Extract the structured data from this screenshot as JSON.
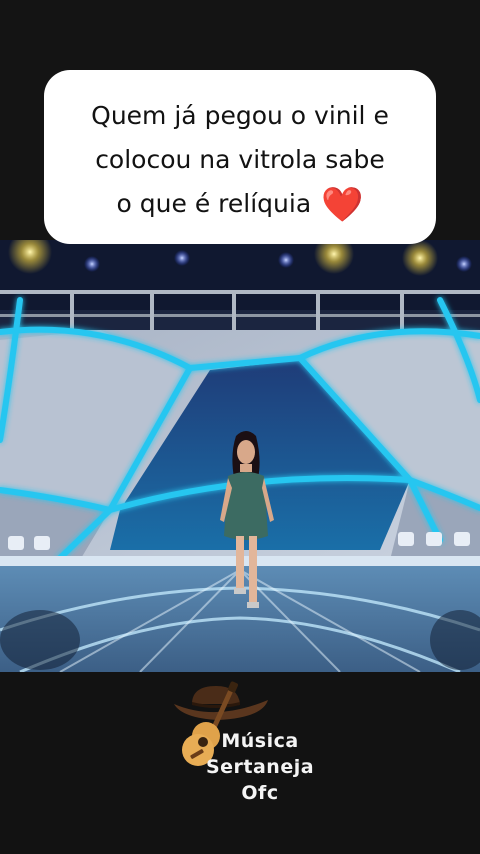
{
  "caption": {
    "line1": "Quem já pegou o vinil e",
    "line2": "colocou na vitrola sabe",
    "line3": "o que é relíquia",
    "emoji": "❤️"
  },
  "video": {
    "scene": "stage-performance"
  },
  "channel_logo": {
    "line1": "Música",
    "line2": "Sertaneja",
    "line3": "Ofc",
    "icons": [
      "cowboy-hat-icon",
      "guitar-icon"
    ]
  },
  "colors": {
    "background": "#121212",
    "caption_bg": "#ffffff",
    "caption_text": "#121212",
    "heart": "#e0142d",
    "stage_neon": "#27c6f0",
    "logo_text": "#f4f4f4"
  }
}
